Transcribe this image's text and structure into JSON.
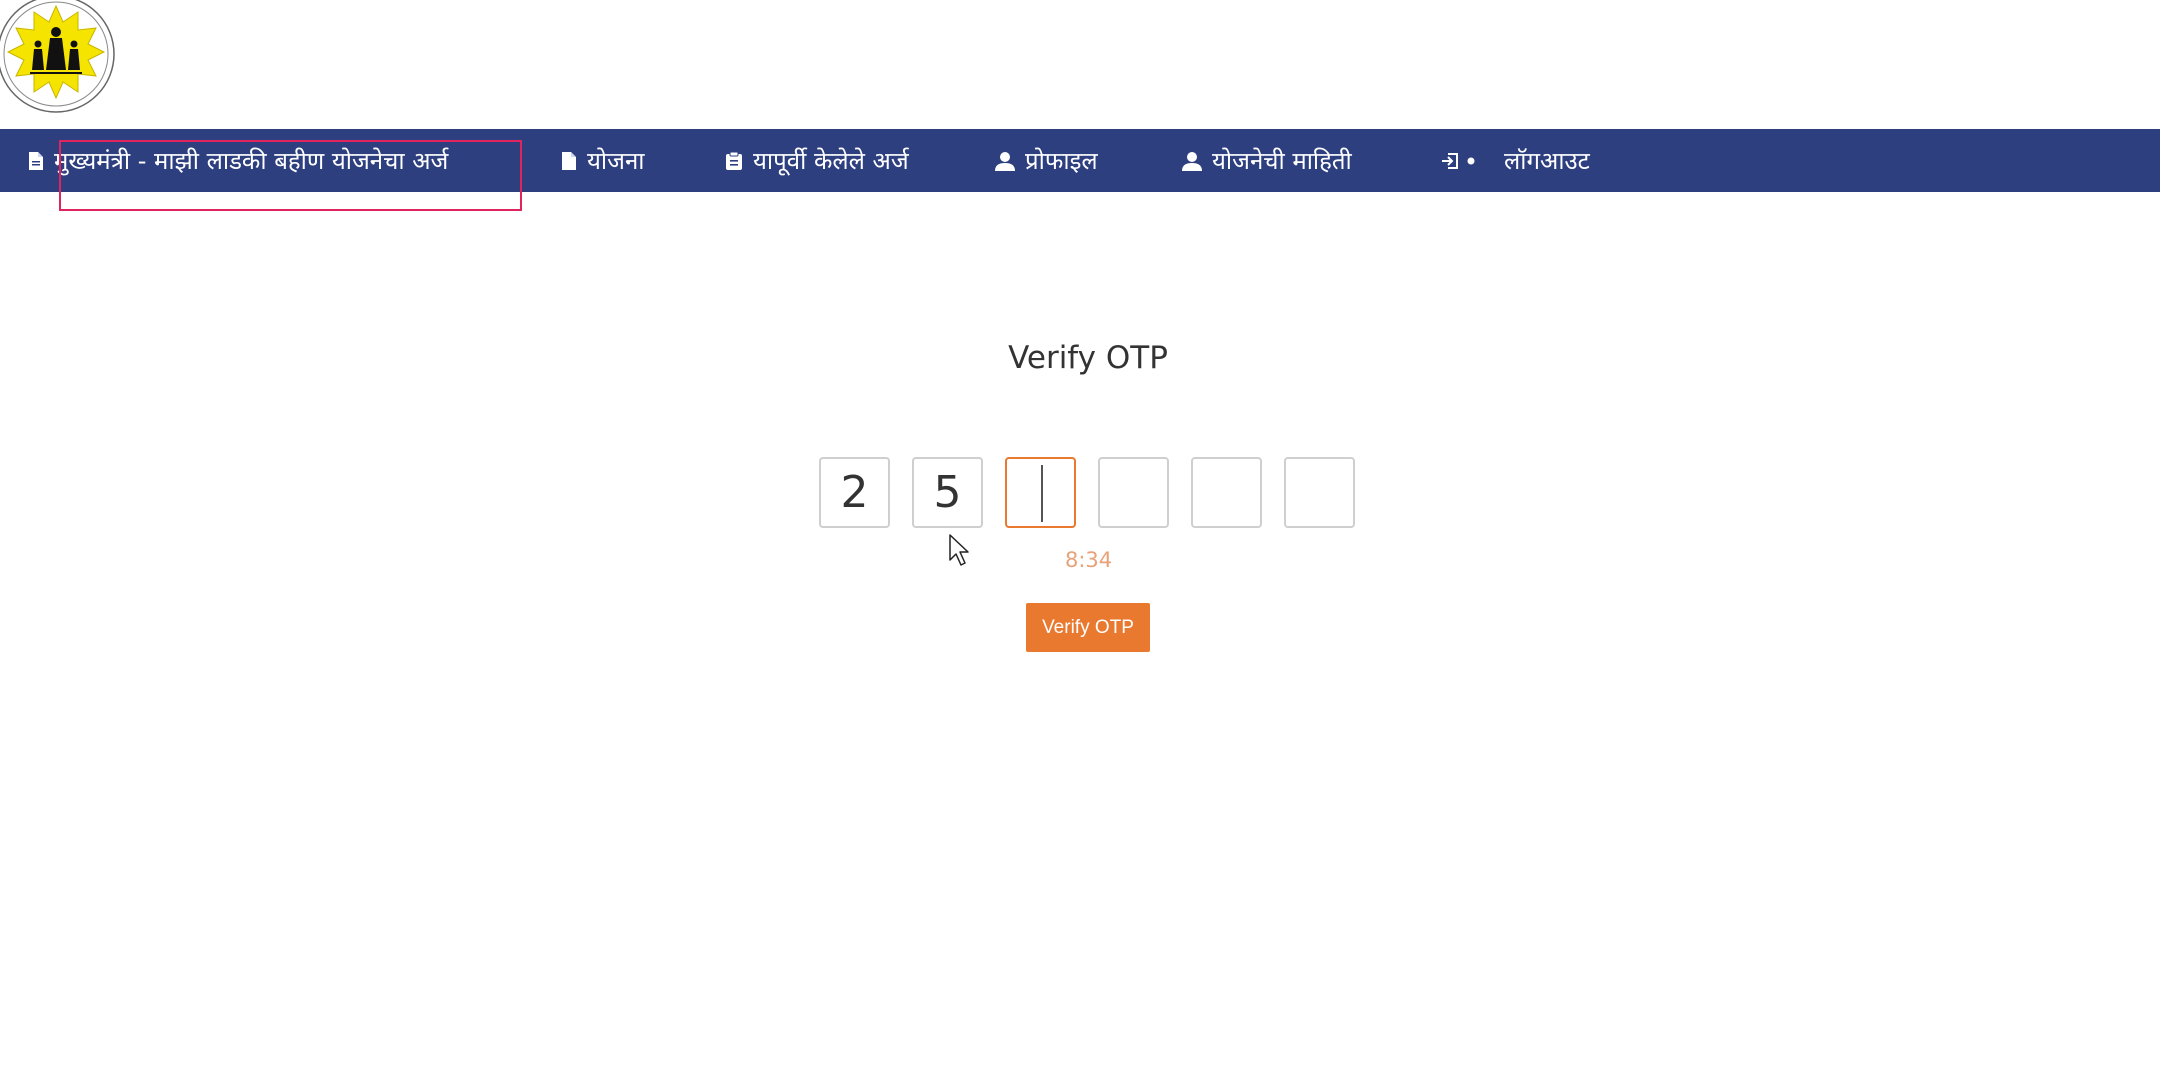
{
  "nav": {
    "items": [
      {
        "label": "मुख्यमंत्री - माझी लाडकी बहीण योजनेचा अर्ज",
        "icon": "document-icon"
      },
      {
        "label": "योजना",
        "icon": "document-icon"
      },
      {
        "label": "यापूर्वी केलेले अर्ज",
        "icon": "clipboard-icon"
      },
      {
        "label": "प्रोफाइल",
        "icon": "user-icon"
      },
      {
        "label": "योजनेची माहिती",
        "icon": "user-icon"
      },
      {
        "label": "लॉगआउट",
        "icon": "logout-icon"
      }
    ]
  },
  "otp": {
    "title": "Verify OTP",
    "digits": [
      "2",
      "5",
      "",
      "",
      "",
      ""
    ],
    "active_index": 2,
    "timer": "8:34",
    "button_label": "Verify OTP"
  },
  "colors": {
    "navbar": "#2e3f80",
    "accent": "#e8792e",
    "highlight": "#e0245e"
  }
}
